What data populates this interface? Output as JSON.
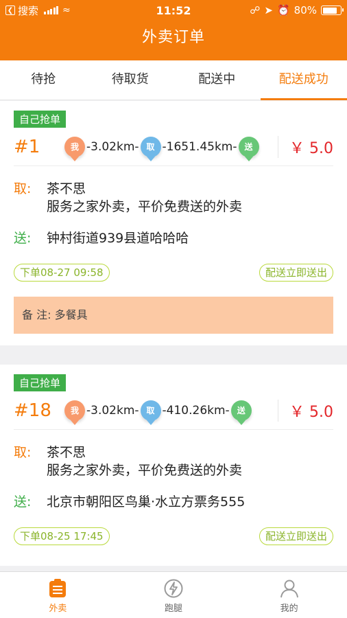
{
  "status_bar": {
    "back_app": "搜索",
    "time": "11:52",
    "battery": "80%",
    "battery_level": 0.8
  },
  "header": {
    "title": "外卖订单"
  },
  "tabs": [
    {
      "label": "待抢",
      "active": false
    },
    {
      "label": "待取货",
      "active": false
    },
    {
      "label": "配送中",
      "active": false
    },
    {
      "label": "配送成功",
      "active": true
    }
  ],
  "orders": [
    {
      "tag": "自己抢单",
      "number": "#1",
      "pin_me": "我",
      "dist_me": "-3.02km-",
      "pin_take": "取",
      "dist_take": "-1651.45km-",
      "pin_send": "送",
      "price": "￥ 5.0",
      "pickup_label": "取:",
      "pickup_name": "茶不思",
      "pickup_desc": "服务之家外卖，平价免费送的外卖",
      "deliver_label": "送:",
      "deliver_addr": "钟村街道939县道哈哈哈",
      "order_time": "下单08-27 09:58",
      "delivery_type": "配送立即送出",
      "note": "备  注:  多餐具"
    },
    {
      "tag": "自己抢单",
      "number": "#18",
      "pin_me": "我",
      "dist_me": "-3.02km-",
      "pin_take": "取",
      "dist_take": "-410.26km-",
      "pin_send": "送",
      "price": "￥ 5.0",
      "pickup_label": "取:",
      "pickup_name": "茶不思",
      "pickup_desc": "服务之家外卖，平价免费送的外卖",
      "deliver_label": "送:",
      "deliver_addr": "北京市朝阳区鸟巢·水立方票务555",
      "order_time": "下单08-25 17:45",
      "delivery_type": "配送立即送出"
    }
  ],
  "bottom_nav": [
    {
      "label": "外卖",
      "icon": "takeout-icon",
      "active": true
    },
    {
      "label": "跑腿",
      "icon": "lightning-icon",
      "active": false
    },
    {
      "label": "我的",
      "icon": "user-icon",
      "active": false
    }
  ],
  "colors": {
    "brand": "#f47c0c",
    "tag_green": "#3fae49",
    "price_red": "#e3262a",
    "note_bg": "#fcc9a4"
  }
}
